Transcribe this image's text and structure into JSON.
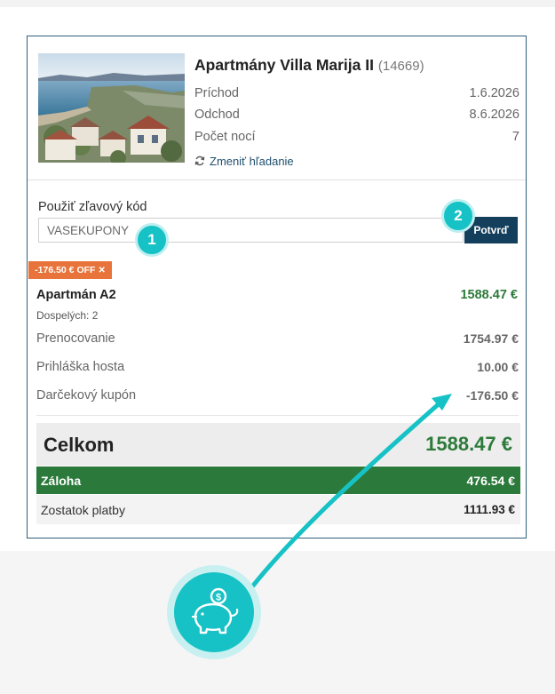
{
  "hotel": {
    "name": "Apartmány Villa Marija II",
    "id": "(14669)",
    "arrival_label": "Príchod",
    "arrival_value": "1.6.2026",
    "departure_label": "Odchod",
    "departure_value": "8.6.2026",
    "nights_label": "Počet nocí",
    "nights_value": "7",
    "change_search": "Zmeniť hľadanie"
  },
  "coupon": {
    "label": "Použiť zľavový kód",
    "value": "VASEKUPONY",
    "confirm": "Potvrď",
    "discount_badge": "-176.50 € OFF",
    "remove_glyph": "✕"
  },
  "steps": [
    "1",
    "2"
  ],
  "booking": {
    "room_name": "Apartmán A2",
    "room_price": "1588.47 €",
    "adults": "Dospelých: 2",
    "items": [
      {
        "label": "Prenocovanie",
        "amount": "1754.97 €"
      },
      {
        "label": "Prihláška hosta",
        "amount": "10.00 €"
      },
      {
        "label": "Darčekový kupón",
        "amount": "-176.50 €"
      }
    ],
    "total_label": "Celkom",
    "total_value": "1588.47 €",
    "deposit_label": "Záloha",
    "deposit_value": "476.54 €",
    "balance_label": "Zostatok platby",
    "balance_value": "1111.93 €"
  },
  "icons": {
    "refresh": "refresh-icon",
    "piggy": "piggy-bank-icon",
    "coin_symbol": "$"
  },
  "colors": {
    "accent_teal": "#16c2c5",
    "navy": "#133f5c",
    "green": "#2b7a3b",
    "orange": "#e8743b"
  }
}
